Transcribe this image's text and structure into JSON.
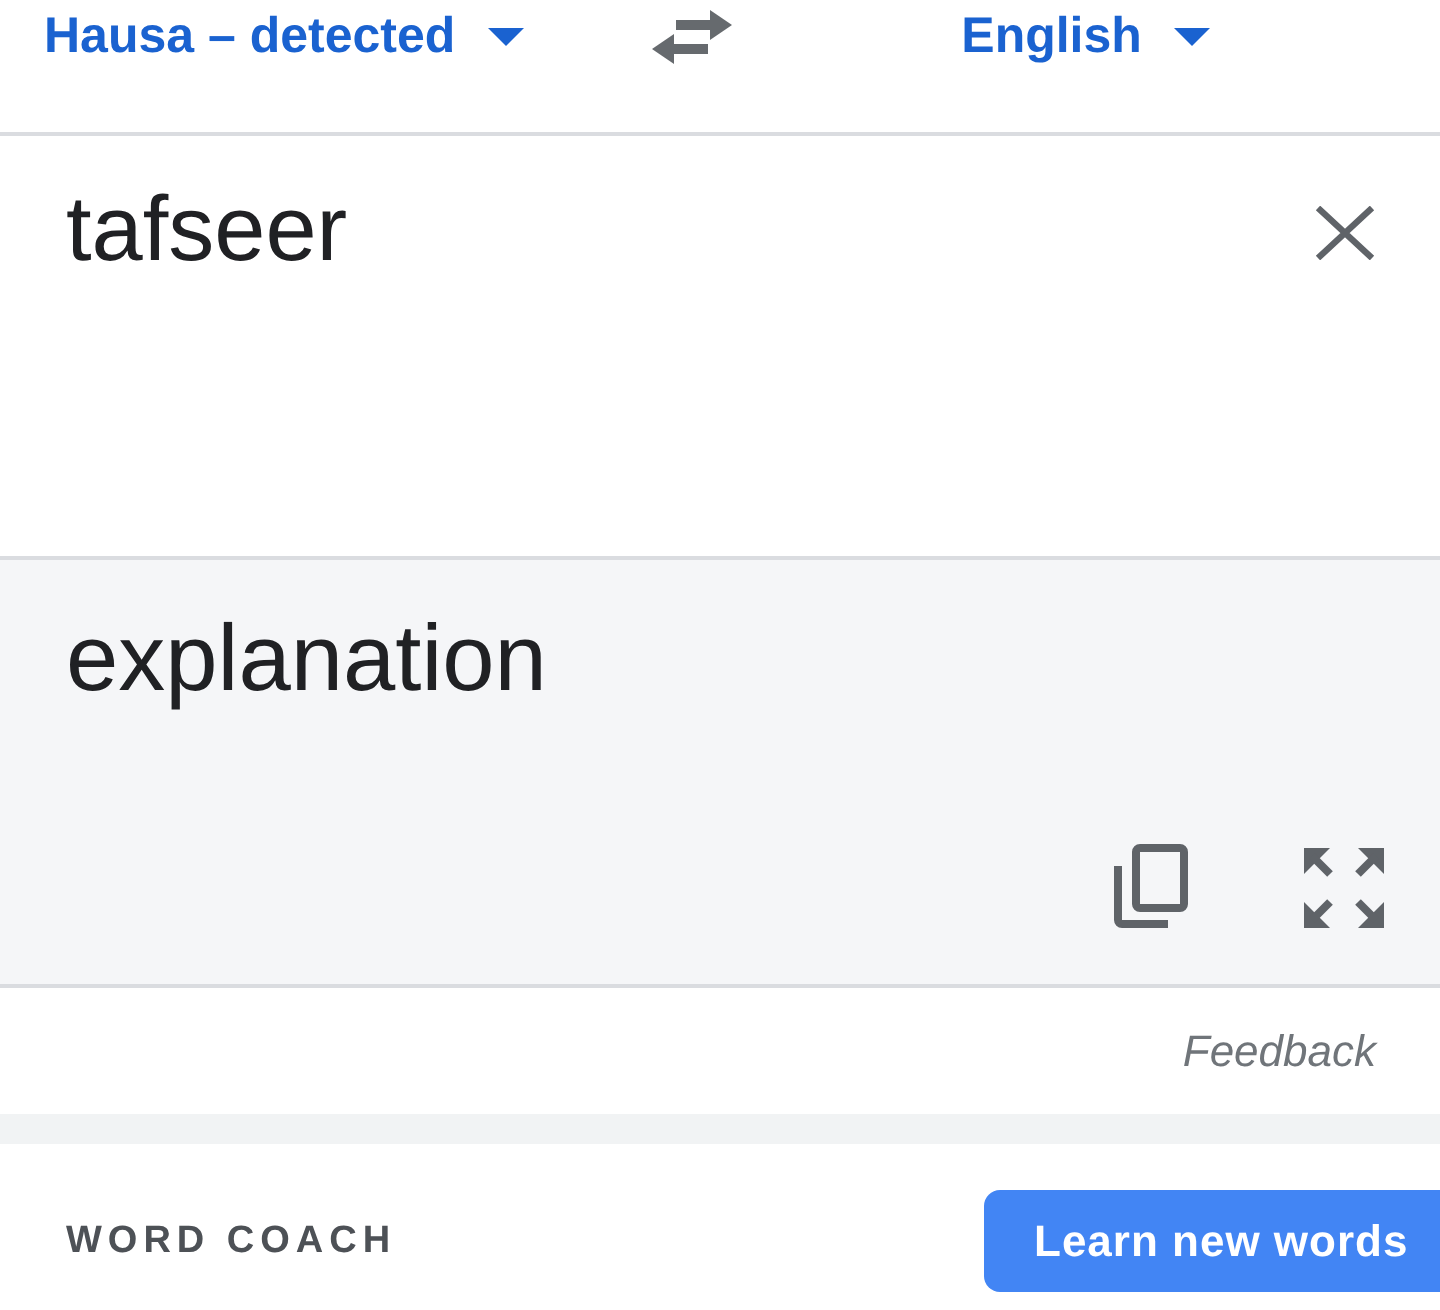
{
  "language_bar": {
    "source_language": "Hausa – detected",
    "target_language": "English"
  },
  "input": {
    "value": "tafseer"
  },
  "output": {
    "text": "explanation"
  },
  "feedback": {
    "label": "Feedback"
  },
  "word_coach": {
    "title": "WORD COACH",
    "button": "Learn new words"
  }
}
